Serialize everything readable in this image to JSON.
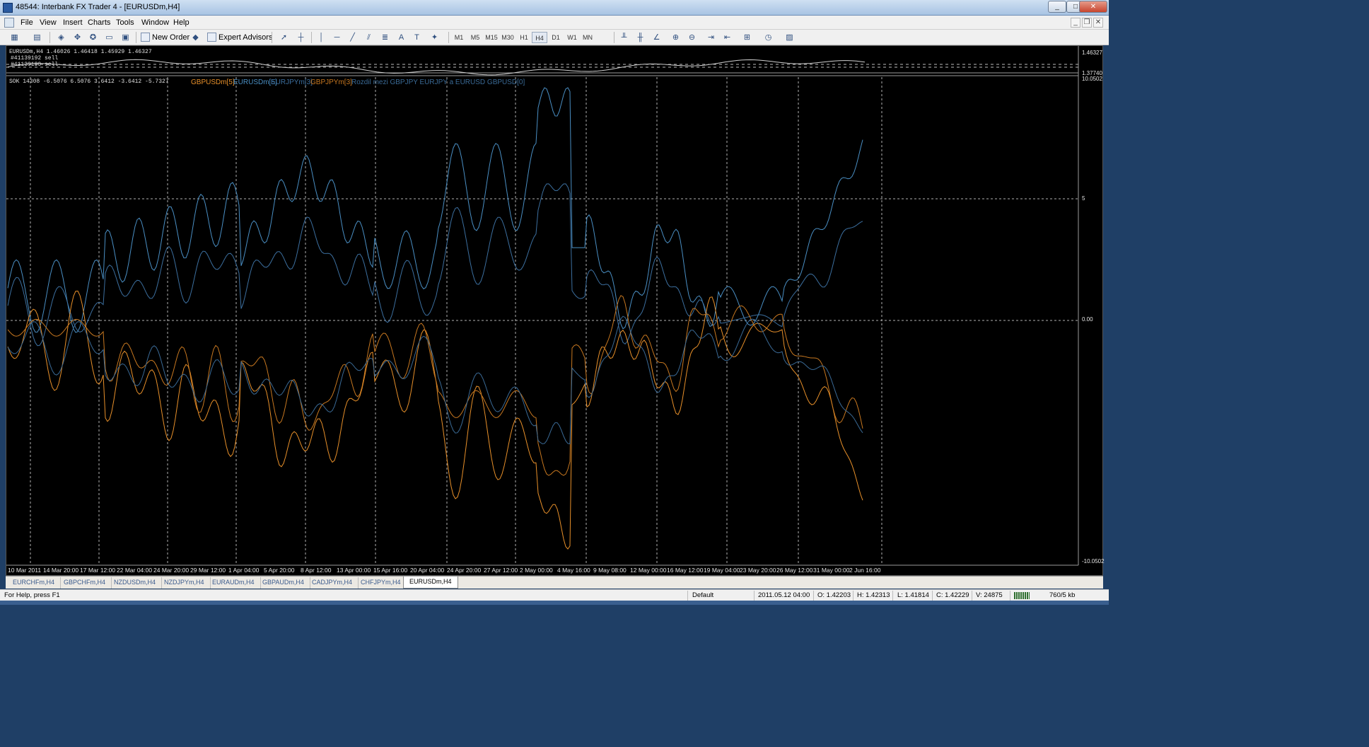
{
  "window": {
    "title": "48544: Interbank FX Trader 4 - [EURUSDm,H4]",
    "minimize": "_",
    "maximize": "□",
    "close": "✕"
  },
  "menu": [
    "File",
    "View",
    "Insert",
    "Charts",
    "Tools",
    "Window",
    "Help"
  ],
  "toolbar": {
    "new_order": "New Order",
    "expert_advisors": "Expert Advisors",
    "timeframes": [
      "M1",
      "M5",
      "M15",
      "M30",
      "H1",
      "H4",
      "D1",
      "W1",
      "MN"
    ],
    "active_timeframe": "H4"
  },
  "chart": {
    "symbol_info": "EURUSDm,H4  1.46026 1.46418 1.45929 1.46327",
    "orders": [
      "#41139192 sell",
      "#41139190 sell"
    ],
    "indicator_info": "SOK 14308 -6.5076 6.5076 3.6412 -3.6412 -5.7327",
    "legend": [
      {
        "text": "GBPUSDm[5]",
        "color": "#e8902a"
      },
      {
        "text": "EURUSDm[5]",
        "color": "#4a8fc4"
      },
      {
        "text": "EURJPYm[3]",
        "color": "#3c6f9f"
      },
      {
        "text": "GBPJPYm[3]",
        "color": "#c87820"
      },
      {
        "text": "Rozdil mezi GBPJPY EURJPY  a EURUSD GBPUSD[0]",
        "color": "#3a6a96"
      }
    ],
    "price_labels": {
      "top": "1.46327",
      "mid": "1.37740"
    },
    "y_labels": [
      {
        "text": "10.0502",
        "value": 10.0502
      },
      {
        "text": "5",
        "value": 5
      },
      {
        "text": "0.00",
        "value": 0
      },
      {
        "text": "-10.0502",
        "value": -10.0502
      }
    ],
    "x_labels": [
      "10 Mar 2011",
      "14 Mar 20:00",
      "17 Mar 12:00",
      "22 Mar 04:00",
      "24 Mar 20:00",
      "29 Mar 12:00",
      "1 Apr 04:00",
      "5 Apr 20:00",
      "8 Apr 12:00",
      "13 Apr 00:00",
      "15 Apr 16:00",
      "20 Apr 04:00",
      "24 Apr 20:00",
      "27 Apr 12:00",
      "2 May 00:00",
      "4 May 16:00",
      "9 May 08:00",
      "12 May 00:00",
      "16 May 12:00",
      "19 May 04:00",
      "23 May 20:00",
      "26 May 12:00",
      "31 May 00:00",
      "2 Jun 16:00"
    ]
  },
  "tabs": [
    "EURCHFm,H4",
    "GBPCHFm,H4",
    "NZDUSDm,H4",
    "NZDJPYm,H4",
    "EURAUDm,H4",
    "GBPAUDm,H4",
    "CADJPYm,H4",
    "CHFJPYm,H4",
    "EURUSDm,H4"
  ],
  "active_tab": "EURUSDm,H4",
  "status": {
    "help": "For Help, press F1",
    "profile": "Default",
    "datetime": "2011.05.12 04:00",
    "open": "O: 1.42203",
    "high": "H: 1.42313",
    "low": "L: 1.41814",
    "close": "C: 1.42229",
    "volume": "V: 24875",
    "traffic": "760/5 kb"
  }
}
